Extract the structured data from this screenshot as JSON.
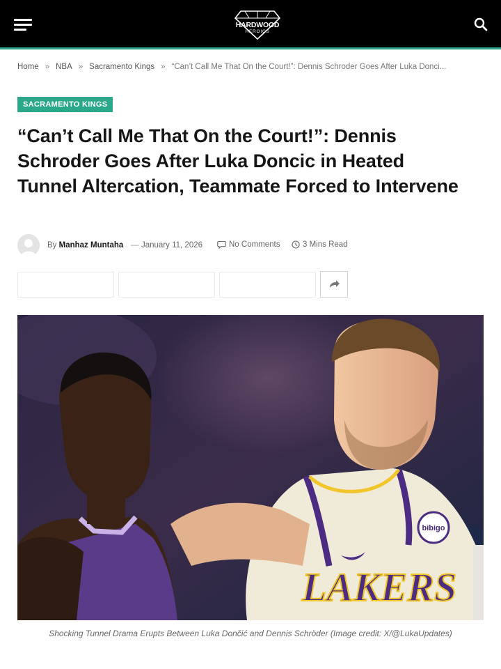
{
  "header": {
    "logo_text": "HARDWOOD",
    "logo_subtext": "HEROICS",
    "menu_icon": "hamburger-menu-icon",
    "search_icon": "search-icon",
    "accent_color": "#2aa889"
  },
  "breadcrumb": {
    "items": [
      "Home",
      "NBA",
      "Sacramento Kings"
    ],
    "separator": "»",
    "current": "“Can’t Call Me That On the Court!”: Dennis Schroder Goes After Luka Donci..."
  },
  "article": {
    "category": "SACRAMENTO KINGS",
    "title": "“Can’t Call Me That On the Court!”: Dennis Schroder Goes After Luka Doncic in Heated Tunnel Altercation, Teammate Forced to Intervene",
    "by_label": "By",
    "author": "Manhaz Muntaha",
    "dash": "—",
    "date": "January 11, 2026",
    "comments": "No Comments",
    "read_time": "3 Mins Read",
    "share_more_icon": "share-arrow-icon",
    "image_jersey_text": "LAKERS",
    "image_patch_text": "bibigo",
    "caption": "Shocking Tunnel Drama Erupts Between Luka Dončić and Dennis Schröder (Image credit: X/@LukaUpdates)"
  }
}
